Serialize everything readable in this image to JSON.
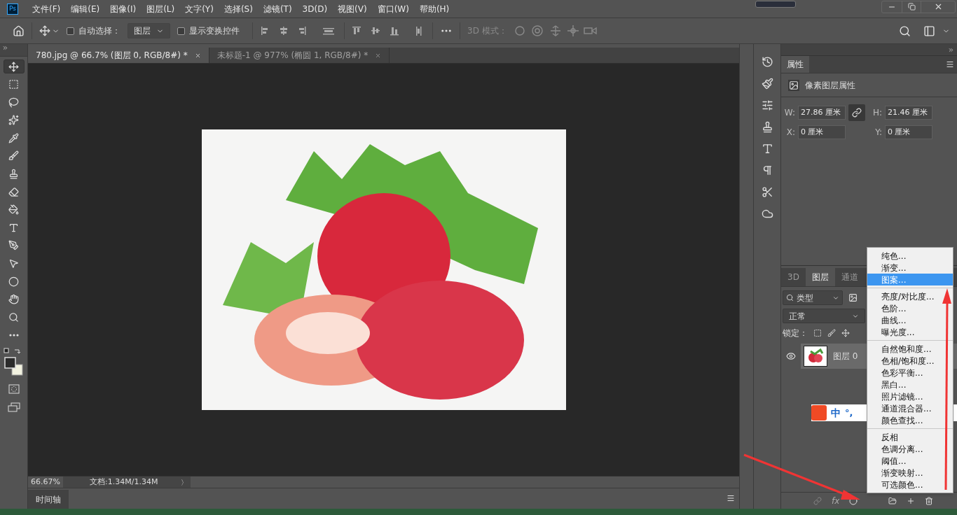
{
  "menu_bar": {
    "app_logo": "Ps",
    "items": [
      "文件(F)",
      "编辑(E)",
      "图像(I)",
      "图层(L)",
      "文字(Y)",
      "选择(S)",
      "滤镜(T)",
      "3D(D)",
      "视图(V)",
      "窗口(W)",
      "帮助(H)"
    ]
  },
  "options_bar": {
    "auto_select": {
      "label": "自动选择：",
      "checked": false
    },
    "auto_select_target": "图层",
    "show_transform": {
      "label": "显示变换控件",
      "checked": false
    },
    "mode_3d_label": "3D 模式："
  },
  "toolbar": {
    "tools": [
      {
        "kind": "move",
        "selected": true
      },
      {
        "kind": "marquee",
        "selected": false
      },
      {
        "kind": "lasso",
        "selected": false
      },
      {
        "kind": "quick",
        "selected": false
      },
      {
        "kind": "eyedropper",
        "selected": false
      },
      {
        "kind": "brush",
        "selected": false
      },
      {
        "kind": "stamp",
        "selected": false
      },
      {
        "kind": "eraser",
        "selected": false
      },
      {
        "kind": "bucket",
        "selected": false
      },
      {
        "kind": "type",
        "selected": false
      },
      {
        "kind": "pen",
        "selected": false
      },
      {
        "kind": "path",
        "selected": false
      },
      {
        "kind": "ellipse",
        "selected": false
      },
      {
        "kind": "hand",
        "selected": false
      },
      {
        "kind": "zoom",
        "selected": false
      },
      {
        "kind": "more",
        "selected": false
      }
    ]
  },
  "document_tabs": [
    {
      "label": "780.jpg @ 66.7% (图层 0, RGB/8#) *",
      "selected": true
    },
    {
      "label": "未标题-1 @ 977% (椭圆 1, RGB/8#) *",
      "selected": false
    }
  ],
  "status_bar": {
    "zoom": "66.67%",
    "doc": "文档:1.34M/1.34M",
    "arrow": "〉"
  },
  "timeline_tab": "时间轴",
  "properties": {
    "tab": "属性",
    "section": "像素图层属性",
    "w_label": "W:",
    "w": "27.86 厘米",
    "h_label": "H:",
    "h": "21.46 厘米",
    "x_label": "X:",
    "x": "0 厘米",
    "y_label": "Y:",
    "y": "0 厘米"
  },
  "layers_panel": {
    "tabs": [
      {
        "label": "3D",
        "selected": false
      },
      {
        "label": "图层",
        "selected": true
      },
      {
        "label": "通道",
        "selected": false
      }
    ],
    "filter": "类型",
    "blend_mode": "正常",
    "lock_label": "锁定：",
    "layers": [
      {
        "name": "图层 0",
        "visible": true,
        "selected": true
      }
    ],
    "fx_button": "fx"
  },
  "ime_bar": {
    "mode": "中",
    "punctuation": "°,"
  },
  "adjustment_menu": {
    "groups": [
      {
        "items": [
          {
            "label": "纯色...",
            "selected": false
          },
          {
            "label": "渐变...",
            "selected": false
          },
          {
            "label": "图案...",
            "selected": true
          }
        ]
      },
      {
        "items": [
          {
            "label": "亮度/对比度...",
            "selected": false
          },
          {
            "label": "色阶...",
            "selected": false
          },
          {
            "label": "曲线...",
            "selected": false
          },
          {
            "label": "曝光度...",
            "selected": false
          }
        ]
      },
      {
        "items": [
          {
            "label": "自然饱和度...",
            "selected": false
          },
          {
            "label": "色相/饱和度...",
            "selected": false
          },
          {
            "label": "色彩平衡...",
            "selected": false
          },
          {
            "label": "黑白...",
            "selected": false
          },
          {
            "label": "照片滤镜...",
            "selected": false
          },
          {
            "label": "通道混合器...",
            "selected": false
          },
          {
            "label": "颜色查找...",
            "selected": false
          }
        ]
      },
      {
        "items": [
          {
            "label": "反相",
            "selected": false
          },
          {
            "label": "色调分离...",
            "selected": false
          },
          {
            "label": "阈值...",
            "selected": false
          },
          {
            "label": "渐变映射...",
            "selected": false
          },
          {
            "label": "可选颜色...",
            "selected": false
          }
        ]
      }
    ]
  }
}
